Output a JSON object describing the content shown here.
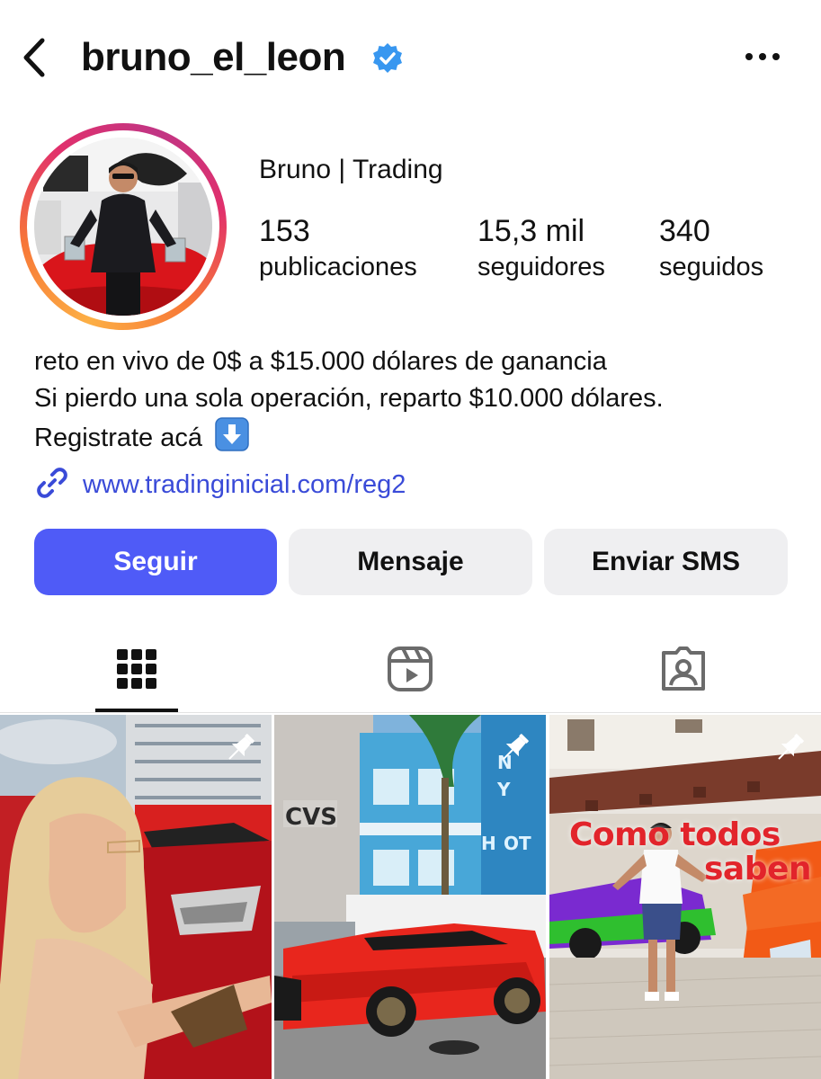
{
  "header": {
    "username": "bruno_el_leon",
    "back_icon": "chevron-left-icon",
    "verified_icon": "verified-badge-icon",
    "more_icon": "more-horizontal-icon"
  },
  "profile": {
    "display_name": "Bruno | Trading",
    "stats": [
      {
        "value": "153",
        "label": "publicaciones"
      },
      {
        "value": "15,3 mil",
        "label": "seguidores"
      },
      {
        "value": "340",
        "label": "seguidos"
      }
    ],
    "bio": [
      "reto en vivo de 0$ a $15.000 dólares de ganancia",
      "Si pierdo una sola operación, reparto $10.000 dólares.",
      "Registrate acá"
    ],
    "link": "www.tradinginicial.com/reg2"
  },
  "actions": {
    "follow": "Seguir",
    "message": "Mensaje",
    "sms": "Enviar SMS"
  },
  "tabs": [
    {
      "icon": "grid-icon",
      "active": true
    },
    {
      "icon": "reels-icon",
      "active": false
    },
    {
      "icon": "tagged-icon",
      "active": false
    }
  ],
  "posts": [
    {
      "pinned": true,
      "overlay": ""
    },
    {
      "pinned": true,
      "overlay": ""
    },
    {
      "pinned": true,
      "overlay_line1": "Como todos",
      "overlay_line2": "saben"
    }
  ],
  "colors": {
    "accent": "#4f5bf7",
    "link": "#3a4bd8",
    "verified": "#3897f0",
    "secondary_button": "#efeff1"
  }
}
